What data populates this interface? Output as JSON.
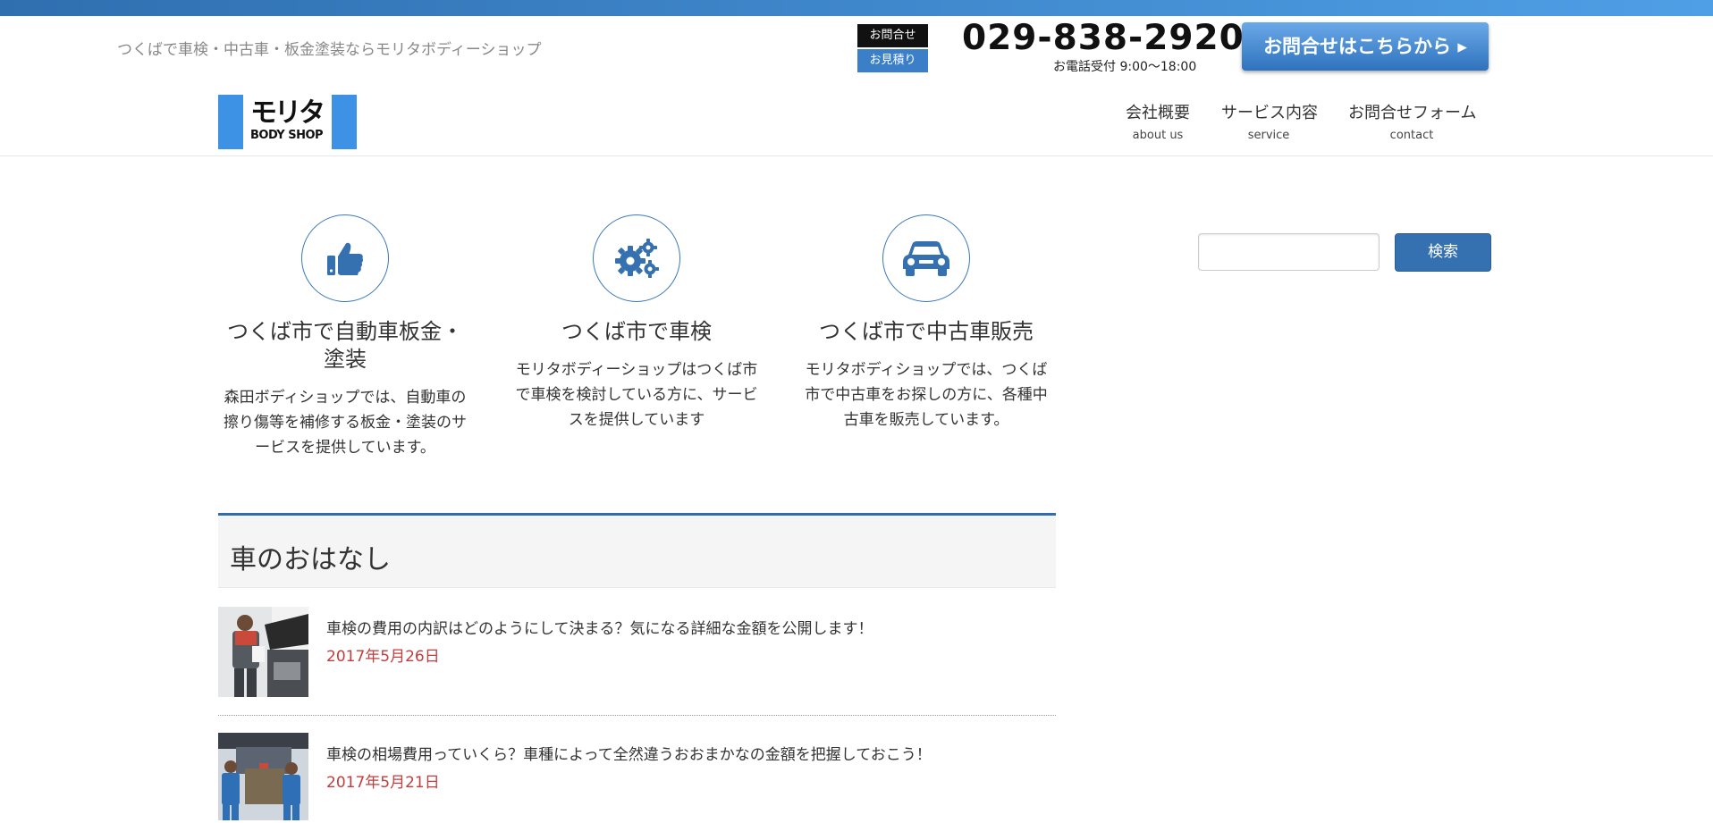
{
  "header": {
    "tagline": "つくばで車検・中古車・板金塗装ならモリタボディーショップ",
    "contact_mini": [
      "お問合せ",
      "お見積り"
    ],
    "phone": "029-838-2920",
    "phone_hours": "お電話受付 9:00〜18:00",
    "contact_button": "お問合せはこちらから ▸",
    "logo_mark": "モリタ",
    "logo_sub": "BODY SHOP"
  },
  "nav": [
    {
      "label": "会社概要",
      "sub": "about us"
    },
    {
      "label": "サービス内容",
      "sub": "service"
    },
    {
      "label": "お問合せフォーム",
      "sub": "contact"
    }
  ],
  "features": [
    {
      "icon": "thumbs-up-icon",
      "title": "つくば市で自動車板金・塗装",
      "text": "森田ボディショップでは、自動車の擦り傷等を補修する板金・塗装のサービスを提供しています。"
    },
    {
      "icon": "gears-icon",
      "title": "つくば市で車検",
      "text": "モリタボディーショップはつくば市で車検を検討している方に、サービスを提供しています"
    },
    {
      "icon": "car-icon",
      "title": "つくば市で中古車販売",
      "text": "モリタボディショップでは、つくば市で中古車をお探しの方に、各種中古車を販売しています。"
    }
  ],
  "search": {
    "placeholder": "",
    "button": "検索"
  },
  "section": {
    "title": "車のおはなし"
  },
  "posts": [
    {
      "title": "車検の費用の内訳はどのようにして決まる？気になる詳細な金額を公開します！",
      "date": "2017年5月26日"
    },
    {
      "title": "車検の相場費用っていくら？車種によって全然違うおおまかなの金額を把握しておこう！",
      "date": "2017年5月21日"
    }
  ],
  "colors": {
    "accent": "#3570b0",
    "date": "#c23d3d",
    "logo_blue": "#3d92e6"
  }
}
